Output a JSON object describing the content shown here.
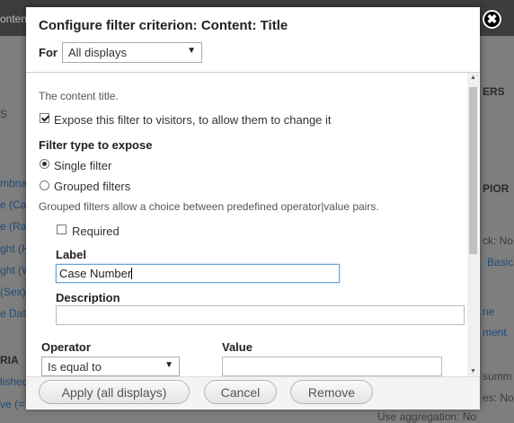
{
  "background": {
    "tab_text": "onten",
    "left_items": [
      "S",
      "mbna",
      "e (Cas",
      "e (Rac",
      "ght (H",
      "ght (W",
      "(Sex)",
      "e Dat",
      "RIA",
      "lished",
      "ve (= "
    ],
    "right_items": [
      "ERS",
      "PIOR",
      "ck: No",
      "Basic",
      "ne",
      "ment",
      "summ",
      "es: No",
      "Use aggregation: No"
    ]
  },
  "modal": {
    "title": "Configure filter criterion: Content: Title",
    "close_symbol": "✖",
    "for_label": "For",
    "for_select": "All displays",
    "description": "The content title.",
    "expose_label": "Expose this filter to visitors, to allow them to change it",
    "expose_checked": true,
    "filter_type_heading": "Filter type to expose",
    "single_filter_label": "Single filter",
    "grouped_filters_label": "Grouped filters",
    "selected_filter_type": "single",
    "grouped_help": "Grouped filters allow a choice between predefined operator|value pairs.",
    "required_label": "Required",
    "required_checked": false,
    "label_heading": "Label",
    "label_value": "Case Number",
    "description_heading": "Description",
    "description_value": "",
    "operator_heading": "Operator",
    "operator_value": "Is equal to",
    "value_heading": "Value",
    "value_value": ""
  },
  "footer": {
    "apply_label": "Apply (all displays)",
    "cancel_label": "Cancel",
    "remove_label": "Remove"
  }
}
